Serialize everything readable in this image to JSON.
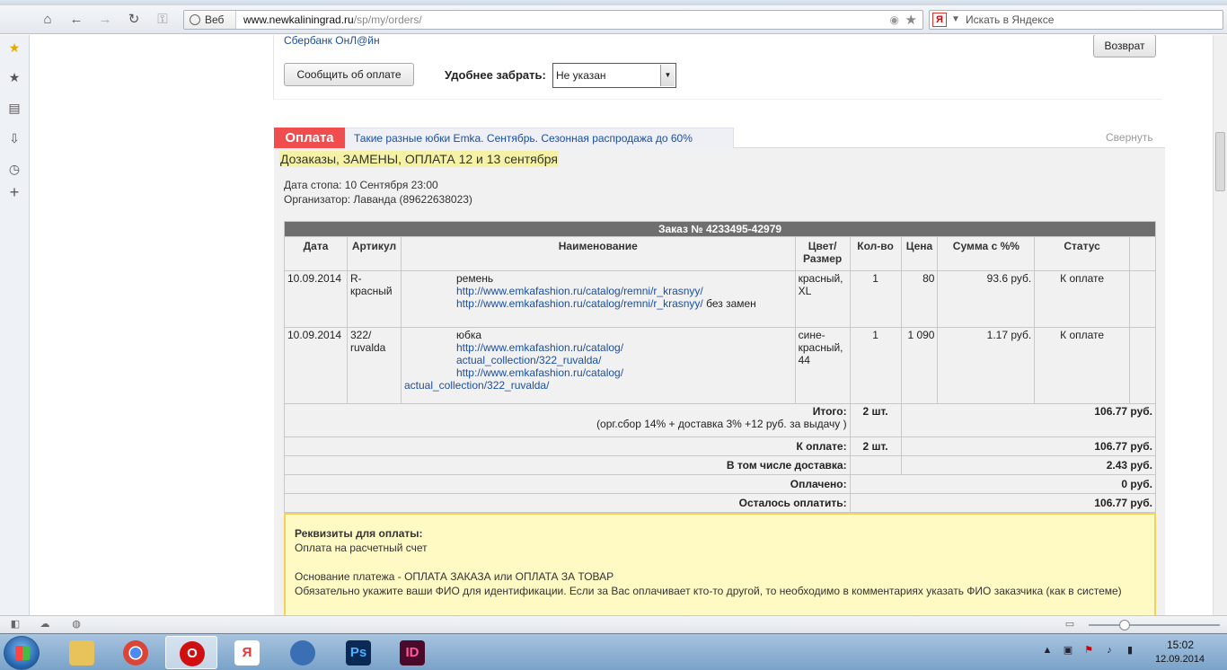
{
  "browser": {
    "web_label": "Веб",
    "url_host": "www.newkaliningrad.ru",
    "url_path": "/sp/my/orders/",
    "search_placeholder": "Искать в Яндексе",
    "ya_label": "Я"
  },
  "page": {
    "payment_method_link": "Сбербанк ОнЛ@йн",
    "report_payment_button": "Сообщить об оплате",
    "return_button": "Возврат",
    "pickup_label": "Удобнее забрать:",
    "pickup_value": "Не указан",
    "section_tab": "Оплата",
    "section_link": "Такие разные юбки Emka. Сентябрь. Сезонная распродажа до 60%",
    "collapse_link": "Свернуть",
    "purchase_title": "Дозаказы, ЗАМЕНЫ, ОПЛАТА 12 и 13 сентября",
    "stop_date": "Дата стопа: 10 Сентября 23:00",
    "organizer": "Организатор: Лаванда (89622638023)"
  },
  "order": {
    "caption": "Заказ № 4233495-42979",
    "columns": [
      "Дата",
      "Артикул",
      "Наименование",
      "Цвет/ Размер",
      "Кол-во",
      "Цена",
      "Сумма с %%",
      "Статус"
    ],
    "rows": [
      {
        "date": "10.09.2014",
        "article": "R-красный",
        "name": "ремень",
        "link1": "http://www.emkafashion.ru/catalog/remni/r_krasnyy/",
        "link2": "http://www.emkafashion.ru/catalog/remni/r_krasnyy/",
        "note": " без замен",
        "color": "красный, XL",
        "qty": "1",
        "price": "80",
        "sum": "93.6 руб.",
        "status": "К оплате"
      },
      {
        "date": "10.09.2014",
        "article": "322/ ruvalda",
        "name": "юбка",
        "link1a": "http://www.emkafashion.ru/catalog/",
        "link1b": "actual_collection/322_ruvalda/",
        "link2a": "http://www.emkafashion.ru/catalog/",
        "link2b": "actual_collection/322_ruvalda/",
        "color": "сине-красный, 44",
        "qty": "1",
        "price": "1 090",
        "sum": "1.17 руб.",
        "status": "К оплате"
      }
    ],
    "total_label": "Итого:",
    "total_note": "(орг.сбор 14% + доставка 3% +12 руб. за выдачу )",
    "total_qty": "2 шт.",
    "total_sum": "106.77 руб.",
    "to_pay_label": "К оплате:",
    "to_pay_qty": "2 шт.",
    "to_pay_sum": "106.77 руб.",
    "delivery_label": "В том числе доставка:",
    "delivery_sum": "2.43 руб.",
    "paid_label": "Оплачено:",
    "paid_sum": "0 руб.",
    "remaining_label": "Осталось оплатить:",
    "remaining_sum": "106.77 руб."
  },
  "requisites": {
    "title": "Реквизиты для оплаты:",
    "line1": "Оплата на расчетный счет",
    "line2": "Основание платежа - ОПЛАТА ЗАКАЗА или ОПЛАТА ЗА ТОВАР",
    "line3": "Обязательно укажите ваши ФИО для идентификации. Если за Вас оплачивает кто-то другой, то необходимо в комментариях указать ФИО заказчика (как в системе)"
  },
  "taskbar": {
    "time": "15:02",
    "date": "12.09.2014",
    "apps": [
      {
        "name": "explorer",
        "label": "",
        "color": "#e8c25a"
      },
      {
        "name": "chrome",
        "label": "",
        "color": "#3b8d3b"
      },
      {
        "name": "opera",
        "label": "O",
        "color": "#d01010"
      },
      {
        "name": "yandex",
        "label": "Я",
        "color": "#e33"
      },
      {
        "name": "sound",
        "label": "",
        "color": "#3a6fb3"
      },
      {
        "name": "photoshop",
        "label": "Ps",
        "color": "#0a2a55"
      },
      {
        "name": "indesign",
        "label": "ID",
        "color": "#4a0b2a"
      }
    ]
  }
}
